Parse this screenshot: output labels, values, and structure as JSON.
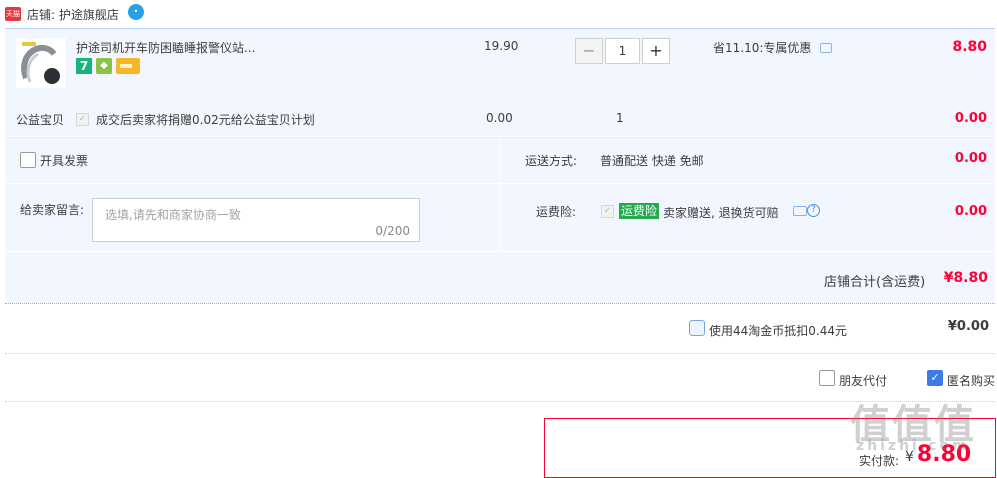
{
  "shop": {
    "badge": "天猫",
    "label": "店铺: 护途旗舰店",
    "chat_icon": "wangwang-icon"
  },
  "item": {
    "title": "护途司机开车防困瞌睡报警仪站...",
    "unit_price": "19.90",
    "quantity": "1",
    "qty_minus": "−",
    "qty_plus": "+",
    "promo": "省11.10:专属优惠",
    "total": "8.80",
    "service_icons": [
      "7-day-return-icon",
      "shield-icon",
      "card-icon"
    ]
  },
  "charity": {
    "label": "公益宝贝",
    "text": "成交后卖家将捐赠0.02元给公益宝贝计划",
    "price": "0.00",
    "quantity": "1",
    "total": "0.00"
  },
  "invoice": {
    "label": "开具发票"
  },
  "shipping": {
    "label": "运送方式:",
    "value": "普通配送 快递 免邮",
    "total": "0.00"
  },
  "message": {
    "label": "给卖家留言:",
    "placeholder": "选填,请先和商家协商一致",
    "counter": "0/200"
  },
  "insurance": {
    "label": "运费险:",
    "badge": "运费险",
    "text": "卖家赠送, 退换货可赔",
    "total": "0.00"
  },
  "shop_total": {
    "label": "店铺合计(含运费)",
    "value": "¥8.80"
  },
  "coins": {
    "text": "使用44淘金币抵扣0.44元",
    "value": "¥0.00"
  },
  "friend_pay": {
    "label": "朋友代付"
  },
  "anonymous": {
    "label": "匿名购买"
  },
  "pay": {
    "label": "实付款:",
    "currency": "¥",
    "amount": "8.80"
  },
  "watermark": {
    "logo": "值值值",
    "url": "zhizhi.com"
  },
  "colors": {
    "price_red": "#ff0036",
    "area_blue": "#f2f7ff",
    "check_blue": "#3b7de4",
    "insurance_green": "#24a94f"
  }
}
